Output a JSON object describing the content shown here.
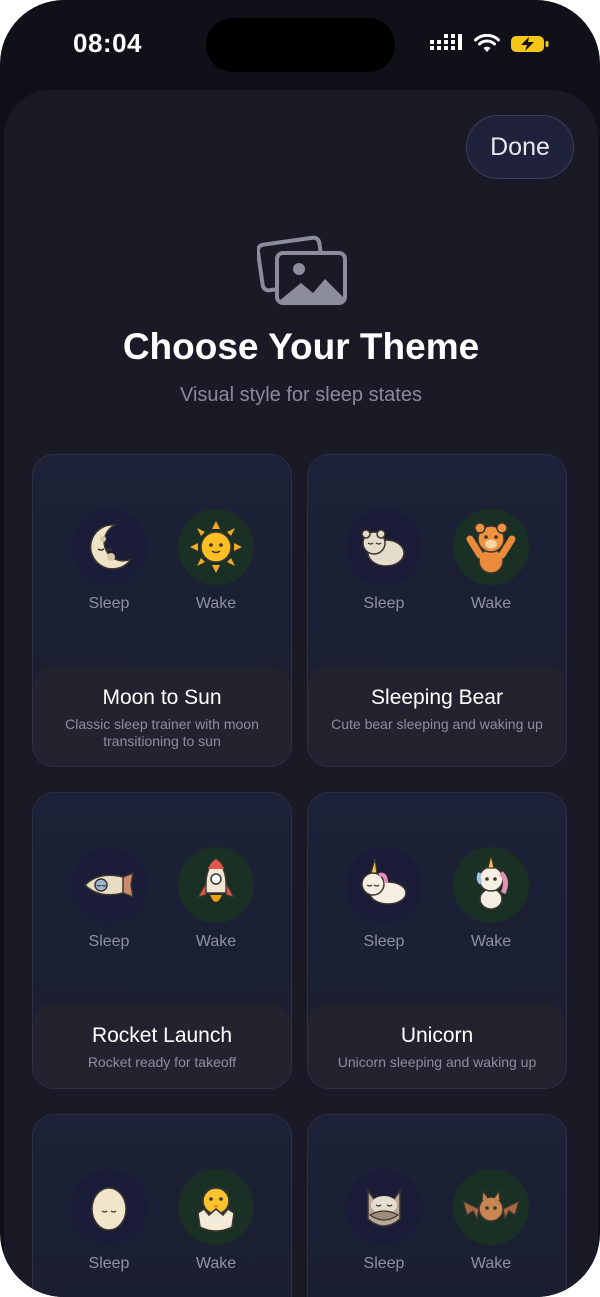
{
  "status": {
    "time": "08:04"
  },
  "header": {
    "done_label": "Done",
    "title": "Choose Your Theme",
    "subtitle": "Visual style for sleep states"
  },
  "labels": {
    "sleep": "Sleep",
    "wake": "Wake"
  },
  "themes": [
    {
      "name": "Moon to Sun",
      "description": "Classic sleep trainer with moon transitioning to sun",
      "sleep_icon": "moon-icon",
      "wake_icon": "sun-icon"
    },
    {
      "name": "Sleeping Bear",
      "description": "Cute bear sleeping and waking up",
      "sleep_icon": "sleeping-bear-icon",
      "wake_icon": "waking-bear-icon"
    },
    {
      "name": "Rocket Launch",
      "description": "Rocket ready for takeoff",
      "sleep_icon": "resting-rocket-icon",
      "wake_icon": "launching-rocket-icon"
    },
    {
      "name": "Unicorn",
      "description": "Unicorn sleeping and waking up",
      "sleep_icon": "sleeping-unicorn-icon",
      "wake_icon": "waking-unicorn-icon"
    },
    {
      "sleep_icon": "egg-icon",
      "wake_icon": "hatched-chick-icon"
    },
    {
      "sleep_icon": "sleeping-owl-icon",
      "wake_icon": "bat-icon"
    }
  ],
  "colors": {
    "background": "#101019",
    "sheet": "#1a1a27",
    "sleep_circle": "#1a1c38",
    "wake_circle": "#1b3024",
    "battery": "#f5c518"
  }
}
